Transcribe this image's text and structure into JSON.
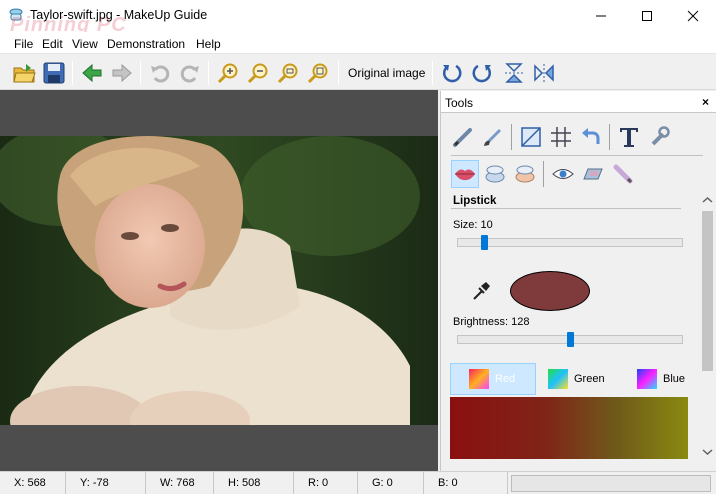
{
  "window": {
    "title": "Taylor-swift.jpg - MakeUp Guide",
    "watermark": "Pinning PC",
    "controls": [
      "minimize-icon",
      "maximize-icon",
      "close-icon"
    ]
  },
  "menu": {
    "items": [
      "File",
      "Edit",
      "View",
      "Demonstration",
      "Help"
    ]
  },
  "toolbar": {
    "buttons": [
      "open-folder-icon",
      "save-disk-icon",
      "back-arrow-icon",
      "forward-arrow-icon",
      "undo-icon",
      "redo-icon",
      "zoom-in-icon",
      "zoom-out-icon",
      "zoom-fit-icon",
      "zoom-actual-icon",
      "rotate-left-icon",
      "rotate-right-icon",
      "flip-vertical-icon",
      "flip-horizontal-icon"
    ],
    "original_image_label": "Original image"
  },
  "tools_panel": {
    "title": "Tools",
    "close_label": "×",
    "row1_icons": [
      "pencil-icon",
      "brush-icon",
      "crop-icon",
      "grid-icon",
      "undo-arrow-icon",
      "text-icon",
      "wrench-icon"
    ],
    "row2_icons": [
      "lips-icon",
      "powder-compact-icon",
      "blush-compact-icon",
      "eye-icon",
      "eyeshadow-icon",
      "eyeliner-icon"
    ],
    "section_title": "Lipstick",
    "size_label": "Size: 10",
    "size_value": 10,
    "brightness_label": "Brightness: 128",
    "brightness_value": 128,
    "selected_color": "#7f3b3b",
    "channels": [
      {
        "label": "Red",
        "active": true
      },
      {
        "label": "Green",
        "active": false
      },
      {
        "label": "Blue",
        "active": false
      }
    ]
  },
  "status": {
    "x": "X: 568",
    "y": "Y: -78",
    "w": "W: 768",
    "h": "H: 508",
    "r": "R: 0",
    "g": "G: 0",
    "b": "B: 0"
  },
  "colors": {
    "accent": "#0078d7",
    "selection": "#cde8ff",
    "viewport_bg": "#4d4d4d"
  }
}
